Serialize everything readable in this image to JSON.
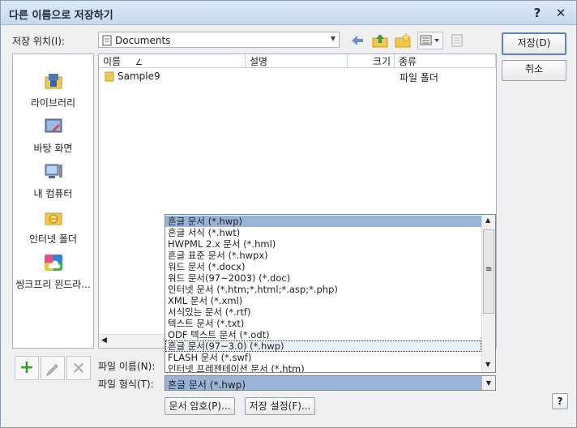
{
  "window": {
    "title": "다른 이름으로 저장하기",
    "help_glyph": "?",
    "close_glyph": "✕"
  },
  "location": {
    "label": "저장 위치(I):",
    "value": "Documents"
  },
  "toolbar": {
    "icons": [
      "back-icon",
      "up-folder-icon",
      "new-folder-icon",
      "view-menu-icon",
      "properties-icon"
    ]
  },
  "places": [
    {
      "label": "라이브러리",
      "icon": "library-icon"
    },
    {
      "label": "바탕 화면",
      "icon": "desktop-icon"
    },
    {
      "label": "내 컴퓨터",
      "icon": "computer-icon"
    },
    {
      "label": "인터넷 폴더",
      "icon": "internet-folder-icon"
    },
    {
      "label": "씽크프리 윈드라...",
      "icon": "thinkfree-icon"
    }
  ],
  "filelist": {
    "columns": [
      "이름",
      "설명",
      "크기",
      "종류"
    ],
    "sort_glyph": "∠",
    "rows": [
      {
        "name": "Sample9",
        "desc": "",
        "size": "",
        "type": "파일 폴더"
      }
    ]
  },
  "buttons": {
    "save": "저장(D)",
    "cancel": "취소",
    "password": "문서 암호(P)...",
    "save_settings": "저장 설정(F)...",
    "help": "?"
  },
  "filename": {
    "label": "파일 이름(N):",
    "value": ""
  },
  "filetype": {
    "label": "파일 형식(T):",
    "value": "흔글 문서 (*.hwp)",
    "options": [
      "흔글 문서 (*.hwp)",
      "흔글 서식 (*.hwt)",
      "HWPML 2.x 문서 (*.hml)",
      "흔글 표준 문서 (*.hwpx)",
      "워드 문서 (*.docx)",
      "워드 문서(97~2003) (*.doc)",
      "인터넷 문서 (*.htm;*.html;*.asp;*.php)",
      "XML 문서 (*.xml)",
      "서식있는 문서 (*.rtf)",
      "텍스트 문서 (*.txt)",
      "ODF 텍스트 문서 (*.odt)",
      "흔글 문서(97~3.0) (*.hwp)",
      "FLASH 문서 (*.swf)",
      "인터넷 프레젠테이션 문서 (*.htm)"
    ],
    "selected_index": 0,
    "hover_index": 11
  },
  "colors": {
    "selection": "#99b4d6",
    "title_bar": "#c8d9ee",
    "green_plus": "#3a9a2e"
  }
}
